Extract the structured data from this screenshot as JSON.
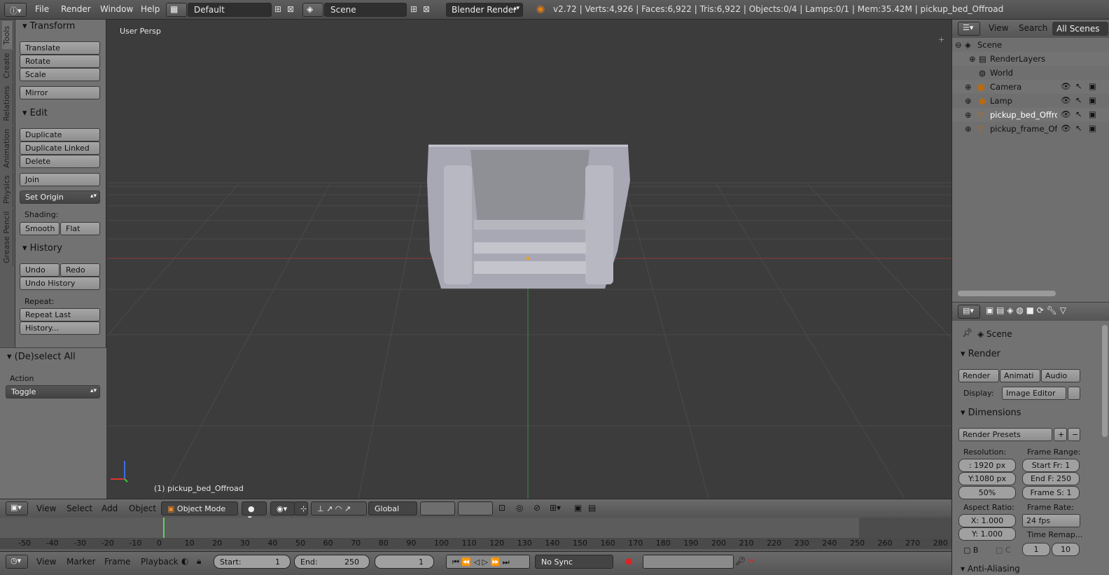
{
  "menu": {
    "file": "File",
    "render": "Render",
    "window": "Window",
    "help": "Help"
  },
  "layout_field": "Default",
  "scene_field": "Scene",
  "engine": "Blender Render",
  "info_text": "v2.72 | Verts:4,926 | Faces:6,922 | Tris:6,922 | Objects:0/4 | Lamps:0/1 | Mem:35.42M | pickup_bed_Offroad",
  "toolshelf": {
    "tabs": [
      "Tools",
      "Create",
      "Relations",
      "Animation",
      "Physics",
      "Grease Pencil"
    ],
    "transform_title": "Transform",
    "translate": "Translate",
    "rotate": "Rotate",
    "scale": "Scale",
    "mirror": "Mirror",
    "edit_title": "Edit",
    "duplicate": "Duplicate",
    "duplicate_linked": "Duplicate Linked",
    "delete": "Delete",
    "join": "Join",
    "set_origin": "Set Origin",
    "shading_label": "Shading:",
    "smooth": "Smooth",
    "flat": "Flat",
    "history_title": "History",
    "undo": "Undo",
    "redo": "Redo",
    "undo_history": "Undo History",
    "repeat_label": "Repeat:",
    "repeat_last": "Repeat Last",
    "history_btn": "History...",
    "operator_title": "(De)select All",
    "action_label": "Action",
    "action_value": "Toggle"
  },
  "viewport": {
    "view_name": "User Persp",
    "object_label": "(1) pickup_bed_Offroad"
  },
  "view3d_header": {
    "view": "View",
    "select": "Select",
    "add": "Add",
    "object": "Object",
    "mode": "Object Mode",
    "orientation": "Global"
  },
  "timeline": {
    "ticks": [
      "-50",
      "-40",
      "-30",
      "-20",
      "-10",
      "0",
      "10",
      "20",
      "30",
      "40",
      "50",
      "60",
      "70",
      "80",
      "90",
      "100",
      "110",
      "120",
      "130",
      "140",
      "150",
      "160",
      "170",
      "180",
      "190",
      "200",
      "210",
      "220",
      "230",
      "240",
      "250",
      "260",
      "270",
      "280"
    ],
    "view": "View",
    "marker": "Marker",
    "frame": "Frame",
    "playback": "Playback",
    "start_label": "Start:",
    "start_value": "1",
    "end_label": "End:",
    "end_value": "250",
    "current": "1",
    "sync": "No Sync"
  },
  "outliner": {
    "view": "View",
    "search": "Search",
    "scope": "All Scenes",
    "rows": [
      "Scene",
      "RenderLayers",
      "World",
      "Camera",
      "Lamp",
      "pickup_bed_Offroac",
      "pickup_frame_Offro"
    ]
  },
  "properties": {
    "scene": "Scene",
    "render_title": "Render",
    "render_btn": "Render",
    "anim_btn": "Animati",
    "audio_btn": "Audio",
    "display_label": "Display:",
    "display_value": "Image Editor",
    "dimensions_title": "Dimensions",
    "presets": "Render Presets",
    "resolution_label": "Resolution:",
    "frame_range_label": "Frame Range:",
    "res_x": ":  1920 px",
    "res_y": "Y:1080 px",
    "res_pct": "50%",
    "start_fr": "Start Fr:  1",
    "end_f": "End F: 250",
    "frame_s": "Frame S: 1",
    "aspect_label": "Aspect Ratio:",
    "frame_rate_label": "Frame Rate:",
    "asp_x": "X:   1.000",
    "asp_y": "Y:   1.000",
    "fps": "24 fps",
    "time_remap": "Time Remap...",
    "b_label": "B",
    "c_label": "C",
    "remap_old": "1",
    "remap_new": "10",
    "aa_title": "Anti-Aliasing"
  }
}
